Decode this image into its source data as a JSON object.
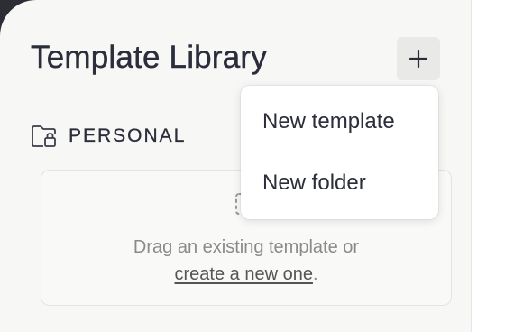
{
  "header": {
    "title": "Template Library",
    "add_button_icon": "plus-icon"
  },
  "section": {
    "label": "PERSONAL",
    "icon": "folder-lock-icon"
  },
  "empty_state": {
    "icon": "template-placeholder-icon",
    "text": "Drag an existing template or",
    "link": "create a new one",
    "suffix": "."
  },
  "menu": {
    "items": [
      {
        "label": "New template"
      },
      {
        "label": "New folder"
      }
    ]
  },
  "colors": {
    "panel_background": "#f7f7f6",
    "text_primary": "#2b2d3a",
    "text_muted": "#8a8a8a",
    "corner_dark": "#2c2d35"
  }
}
